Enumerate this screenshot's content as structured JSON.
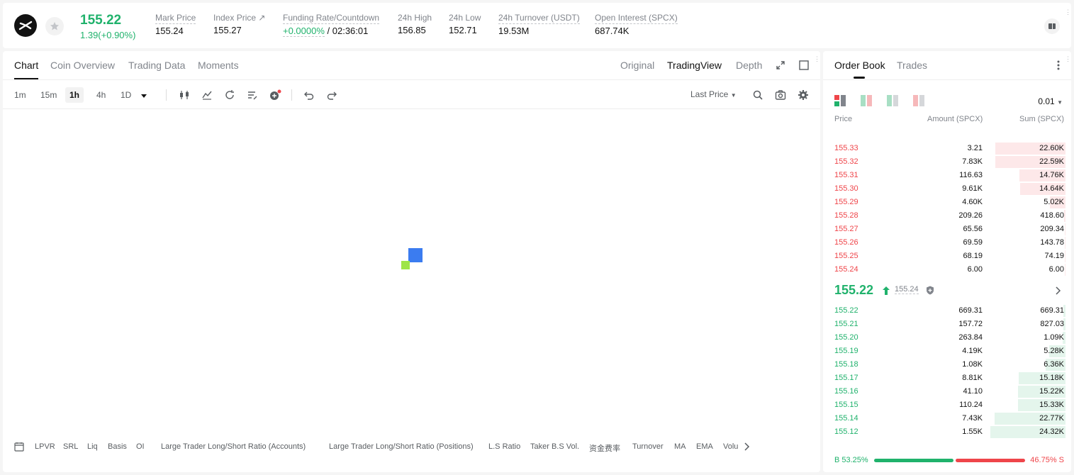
{
  "header": {
    "last_price": "155.22",
    "change": "1.39(+0.90%)",
    "stats": [
      {
        "label": "Mark Price",
        "value": "155.24"
      },
      {
        "label": "Index Price ↗",
        "value": "155.27"
      },
      {
        "label": "Funding Rate/Countdown",
        "value_green": "+0.0000%",
        "value_rest": " / 02:36:01"
      },
      {
        "label": "24h High",
        "value": "156.85"
      },
      {
        "label": "24h Low",
        "value": "152.71"
      },
      {
        "label": "24h Turnover (USDT)",
        "value": "19.53M"
      },
      {
        "label": "Open Interest (SPCX)",
        "value": "687.74K"
      }
    ]
  },
  "chart_panel": {
    "tabs": [
      "Chart",
      "Coin Overview",
      "Trading Data",
      "Moments"
    ],
    "views": [
      "Original",
      "TradingView",
      "Depth"
    ],
    "timeframes": [
      "1m",
      "15m",
      "1h",
      "4h",
      "1D"
    ],
    "price_source": "Last Price",
    "indicators": [
      "LPVR",
      "SRL",
      "Liq",
      "Basis",
      "OI",
      "Large Trader Long/Short Ratio (Accounts)",
      "Large Trader Long/Short Ratio (Positions)",
      "L.S Ratio",
      "Taker B.S Vol.",
      "资金费率",
      "Turnover",
      "MA",
      "EMA",
      "Volu"
    ]
  },
  "order_book": {
    "tabs": [
      "Order Book",
      "Trades"
    ],
    "precision": "0.01",
    "columns": [
      "Price",
      "Amount (SPCX)",
      "Sum (SPCX)"
    ],
    "asks": [
      {
        "price": "155.33",
        "amount": "3.21",
        "sum": "22.60K",
        "depth": 0.93
      },
      {
        "price": "155.32",
        "amount": "7.83K",
        "sum": "22.59K",
        "depth": 0.93
      },
      {
        "price": "155.31",
        "amount": "116.63",
        "sum": "14.76K",
        "depth": 0.61
      },
      {
        "price": "155.30",
        "amount": "9.61K",
        "sum": "14.64K",
        "depth": 0.6
      },
      {
        "price": "155.29",
        "amount": "4.60K",
        "sum": "5.02K",
        "depth": 0.21
      },
      {
        "price": "155.28",
        "amount": "209.26",
        "sum": "418.60",
        "depth": 0.02
      },
      {
        "price": "155.27",
        "amount": "65.56",
        "sum": "209.34",
        "depth": 0.01
      },
      {
        "price": "155.26",
        "amount": "69.59",
        "sum": "143.78",
        "depth": 0.01
      },
      {
        "price": "155.25",
        "amount": "68.19",
        "sum": "74.19",
        "depth": 0.005
      },
      {
        "price": "155.24",
        "amount": "6.00",
        "sum": "6.00",
        "depth": 0.002
      }
    ],
    "mid_price": "155.22",
    "mark_price": "155.24",
    "bids": [
      {
        "price": "155.22",
        "amount": "669.31",
        "sum": "669.31",
        "depth": 0.03
      },
      {
        "price": "155.21",
        "amount": "157.72",
        "sum": "827.03",
        "depth": 0.03
      },
      {
        "price": "155.20",
        "amount": "263.84",
        "sum": "1.09K",
        "depth": 0.04
      },
      {
        "price": "155.19",
        "amount": "4.19K",
        "sum": "5.28K",
        "depth": 0.22
      },
      {
        "price": "155.18",
        "amount": "1.08K",
        "sum": "6.36K",
        "depth": 0.26
      },
      {
        "price": "155.17",
        "amount": "8.81K",
        "sum": "15.18K",
        "depth": 0.62
      },
      {
        "price": "155.16",
        "amount": "41.10",
        "sum": "15.22K",
        "depth": 0.63
      },
      {
        "price": "155.15",
        "amount": "110.24",
        "sum": "15.33K",
        "depth": 0.63
      },
      {
        "price": "155.14",
        "amount": "7.43K",
        "sum": "22.77K",
        "depth": 0.94
      },
      {
        "price": "155.12",
        "amount": "1.55K",
        "sum": "24.32K",
        "depth": 1.0
      }
    ],
    "buy_ratio": "B 53.25%",
    "sell_ratio": "46.75% S"
  },
  "colors": {
    "green": "#20b26c",
    "red": "#ef454a",
    "accent_blue": "#3b7cf0"
  }
}
